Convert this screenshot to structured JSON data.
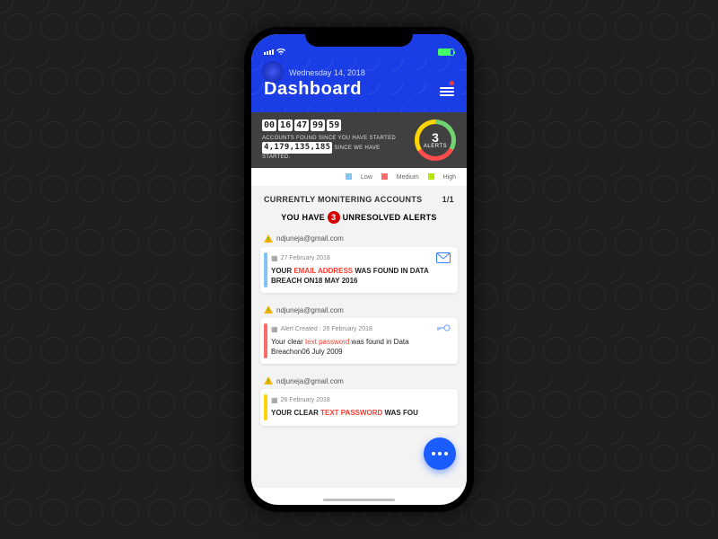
{
  "status": {
    "signal": "•••",
    "carrier": "",
    "battery": 80
  },
  "header": {
    "date": "Wednesday 14, 2018",
    "title": "Dashboard"
  },
  "counter": {
    "digits": [
      "00",
      "16",
      "47",
      "99",
      "59"
    ],
    "line1": "ACCOUNTS FOUND SINCE YOU HAVE STARTED",
    "bignum": "4,179,135,185",
    "line2": "SINCE WE HAVE STARTED.",
    "alerts_count": "3",
    "alerts_label": "ALERTS"
  },
  "legend": {
    "low": "Low",
    "medium": "Medium",
    "high": "High"
  },
  "monitor": {
    "label": "CURRENTLY MONITERING ACCOUNTS",
    "count": "1/1"
  },
  "unresolved": {
    "pre": "YOU HAVE",
    "count": "3",
    "post": "UNRESOLVED ALERTS"
  },
  "account_email": "ndjuneja@gmail.com",
  "cards": [
    {
      "bar_color": "#7fc4f2",
      "date": "27 February 2018",
      "msg_pre": "YOUR ",
      "msg_em": "EMAIL ADDRESS",
      "msg_post": " WAS FOUND IN DATA BREACH ON18 MAY 2016",
      "icon": "mail",
      "upper": true
    },
    {
      "bar_color": "#ff6b6b",
      "date": "Alert Created : 26 February 2018",
      "msg_pre": "Your clear ",
      "msg_em": "text password",
      "msg_post": " was found in Data Breachon06 July 2009",
      "icon": "key",
      "upper": false
    },
    {
      "bar_color": "#ffd400",
      "date": "26 February 2018",
      "msg_pre": "YOUR CLEAR ",
      "msg_em": "TEXT PASSWORD",
      "msg_post": " WAS FOU",
      "icon": "",
      "upper": true
    }
  ]
}
